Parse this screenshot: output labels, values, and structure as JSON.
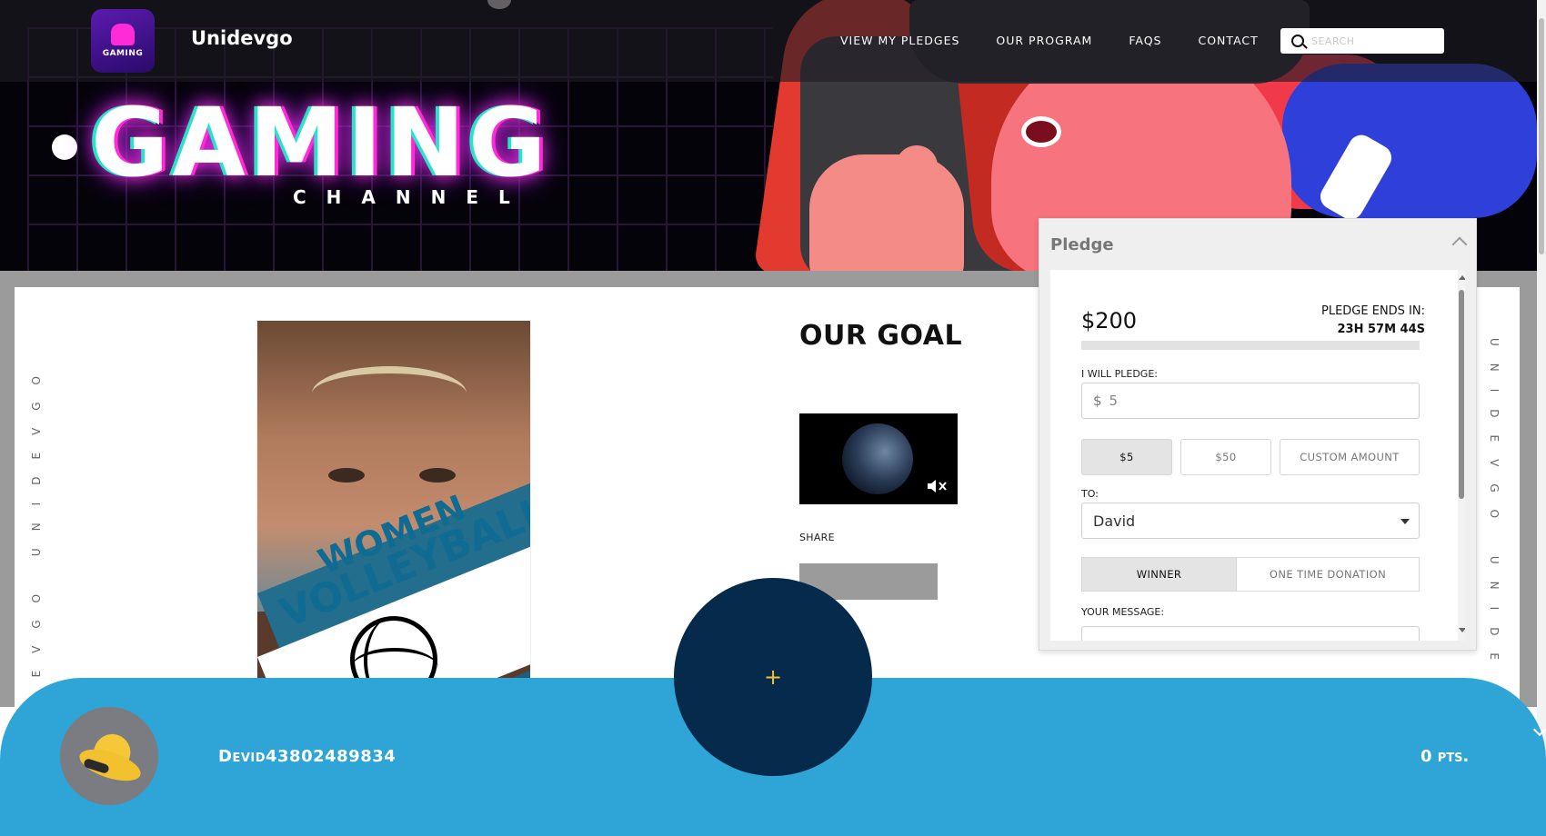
{
  "header": {
    "brand": "Unidevgo",
    "logo_text": "GAMING",
    "nav": [
      {
        "label": "VIEW MY PLEDGES"
      },
      {
        "label": "OUR PROGRAM"
      },
      {
        "label": "FAQS"
      },
      {
        "label": "CONTACT"
      }
    ],
    "search_placeholder": "SEARCH"
  },
  "hero": {
    "title": "GAMING",
    "subtitle": "CHANNEL"
  },
  "side_text": {
    "left": "UNIDEVGO UNIDEVGO",
    "right": "UNIDEVGO UNIDE"
  },
  "poster": {
    "line1": "WOMEN",
    "line2": "VOLLEYBALL"
  },
  "goal": {
    "title": "OUR GOAL",
    "share_label": "SHARE"
  },
  "pledge": {
    "heading": "Pledge",
    "amount": "$200",
    "ends_label": "PLEDGE ENDS IN:",
    "ends_time": "23H 57M 44S",
    "progress_fraction": 0,
    "will_pledge_label": "I WILL PLEDGE:",
    "currency": "$",
    "amount_value": "5",
    "chips": [
      {
        "label": "$5",
        "active": true
      },
      {
        "label": "$50",
        "active": false
      },
      {
        "label": "CUSTOM AMOUNT",
        "active": false
      }
    ],
    "to_label": "TO:",
    "to_value": "David",
    "type_options": [
      {
        "label": "WINNER",
        "active": true
      },
      {
        "label": "ONE TIME DONATION",
        "active": false
      }
    ],
    "message_label": "YOUR MESSAGE:"
  },
  "footer": {
    "username": "Devid43802489834",
    "points": "0 pts.",
    "fab_symbol": "+"
  },
  "colors": {
    "bottom_bar": "#2fa4d6",
    "fab": "#062a4b",
    "accent_yellow": "#f2c12e",
    "neon_pink": "#ff2bd6",
    "neon_teal": "#23e6c6"
  }
}
